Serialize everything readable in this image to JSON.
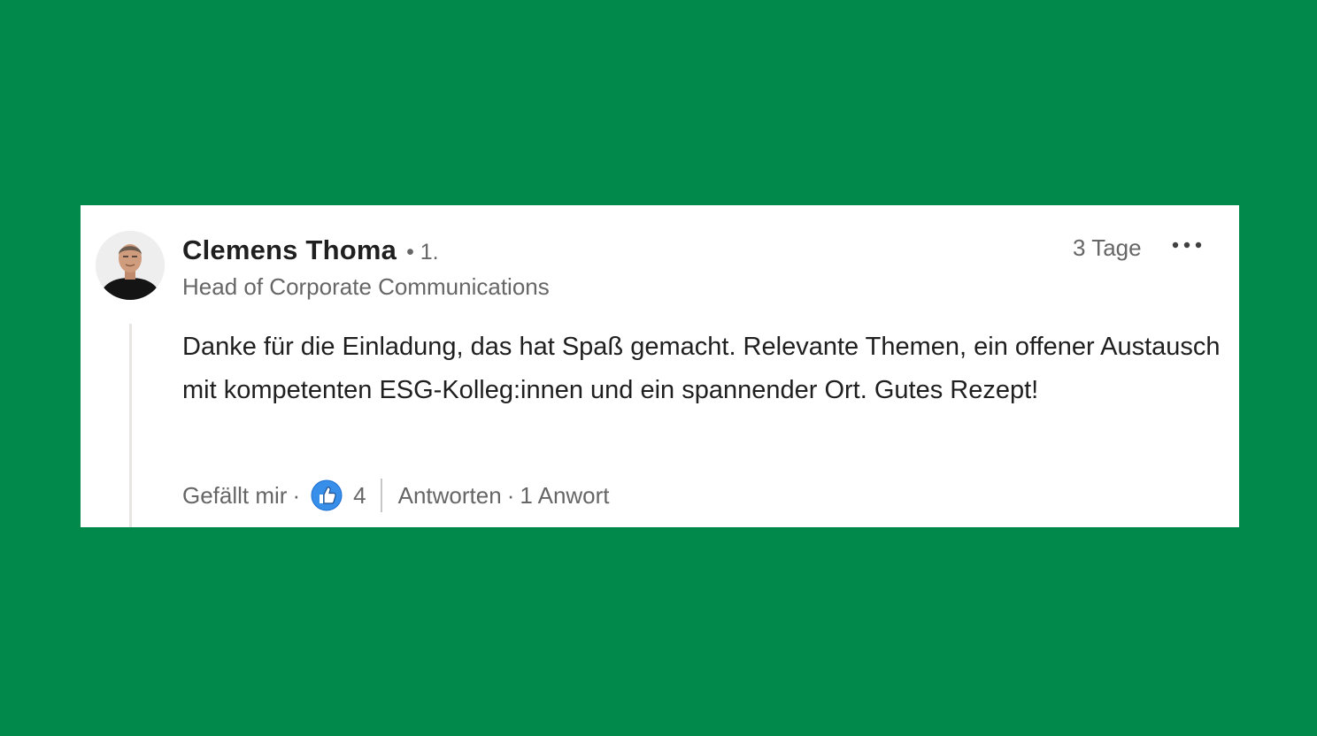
{
  "comment": {
    "author": "Clemens Thoma",
    "degree": "• 1.",
    "headline": "Head of Corporate Communications",
    "time": "3 Tage",
    "body": "Danke für die Einladung, das hat Spaß gemacht. Relevante Themen, ein offener Austausch mit kompetenten ESG-Kolleg:innen und ein spannender Ort. Gutes Rezept!",
    "like_label": "Gefällt mir",
    "reaction_count": "4",
    "reply_label": "Antworten",
    "reply_count": "1 Anwort",
    "separator": "·"
  },
  "icons": {
    "more": "more-options-icon",
    "reaction": "like-reaction-icon"
  },
  "colors": {
    "background": "#00894a",
    "card": "#ffffff",
    "text_primary": "#1f1f1f",
    "text_secondary": "#666666",
    "like_blue": "#378fe9"
  }
}
